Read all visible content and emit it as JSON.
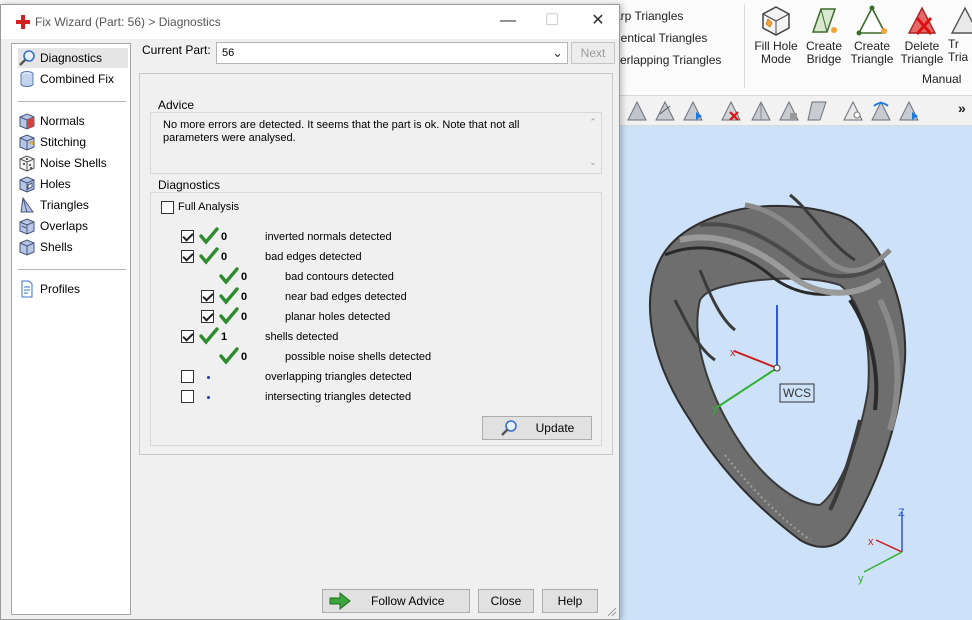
{
  "dialog": {
    "title": "Fix Wizard (Part: 56) > Diagnostics",
    "window_controls": {
      "minimize": "—",
      "maximize": "☐",
      "close": "✕"
    }
  },
  "sidebar": {
    "items": [
      {
        "label": "Diagnostics",
        "icon": "magnifier-icon",
        "selected": true
      },
      {
        "label": "Combined Fix",
        "icon": "cylinder-icon"
      },
      {
        "label": "Normals",
        "icon": "cube-normals-icon"
      },
      {
        "label": "Stitching",
        "icon": "cube-stitching-icon"
      },
      {
        "label": "Noise Shells",
        "icon": "dice-icon"
      },
      {
        "label": "Holes",
        "icon": "cube-holes-icon"
      },
      {
        "label": "Triangles",
        "icon": "triangle-icon"
      },
      {
        "label": "Overlaps",
        "icon": "cube-overlaps-icon"
      },
      {
        "label": "Shells",
        "icon": "cube-shells-icon"
      },
      {
        "label": "Profiles",
        "icon": "document-icon"
      }
    ]
  },
  "current_part": {
    "label": "Current Part:",
    "value": "56",
    "next_label": "Next"
  },
  "advice": {
    "title": "Advice",
    "text": "No more errors are detected. It seems that the part is ok. Note that not all parameters were analysed."
  },
  "diagnostics": {
    "title": "Diagnostics",
    "full_analysis_label": "Full Analysis",
    "full_analysis_checked": false,
    "rows": [
      {
        "checked": true,
        "status": "ok",
        "count": "0",
        "text": "inverted normals detected",
        "indent": 0
      },
      {
        "checked": true,
        "status": "ok",
        "count": "0",
        "text": "bad edges detected",
        "indent": 0
      },
      {
        "checked": null,
        "status": "ok",
        "count": "0",
        "text": "bad contours detected",
        "indent": 1
      },
      {
        "checked": true,
        "status": "ok",
        "count": "0",
        "text": "near bad edges detected",
        "indent": 1
      },
      {
        "checked": true,
        "status": "ok",
        "count": "0",
        "text": "planar holes detected",
        "indent": 1
      },
      {
        "checked": true,
        "status": "ok",
        "count": "1",
        "text": "shells detected",
        "indent": 0
      },
      {
        "checked": null,
        "status": "ok",
        "count": "0",
        "text": "possible noise shells detected",
        "indent": 1
      },
      {
        "checked": false,
        "status": "pending",
        "count": "",
        "text": "overlapping triangles detected",
        "indent": 0
      },
      {
        "checked": false,
        "status": "pending",
        "count": "",
        "text": "intersecting triangles detected",
        "indent": 0
      }
    ],
    "update_label": "Update"
  },
  "footer": {
    "follow_advice_label": "Follow Advice",
    "close_label": "Close",
    "help_label": "Help"
  },
  "ribbon": {
    "left_links": [
      "arp Triangles",
      "dentical Triangles",
      "verlapping Triangles"
    ],
    "buttons": [
      {
        "label": "Fill Hole\nMode",
        "icon": "fill-hole-icon"
      },
      {
        "label": "Create\nBridge",
        "icon": "create-bridge-icon"
      },
      {
        "label": "Create\nTriangle",
        "icon": "create-triangle-icon"
      },
      {
        "label": "Delete\nTriangle",
        "icon": "delete-triangle-icon"
      },
      {
        "label": "Tr\nTria",
        "icon": "triangle-icon"
      }
    ],
    "group_label": "Manual",
    "more": "»"
  },
  "viewport": {
    "wcs_label": "WCS",
    "axis_x": "x",
    "axis_y": "y",
    "axis_z": "Z"
  },
  "colors": {
    "ok_check": "#2e8b2e",
    "viewport_bg": "#cde2f8",
    "pending_dot": "#1a3ca8"
  }
}
